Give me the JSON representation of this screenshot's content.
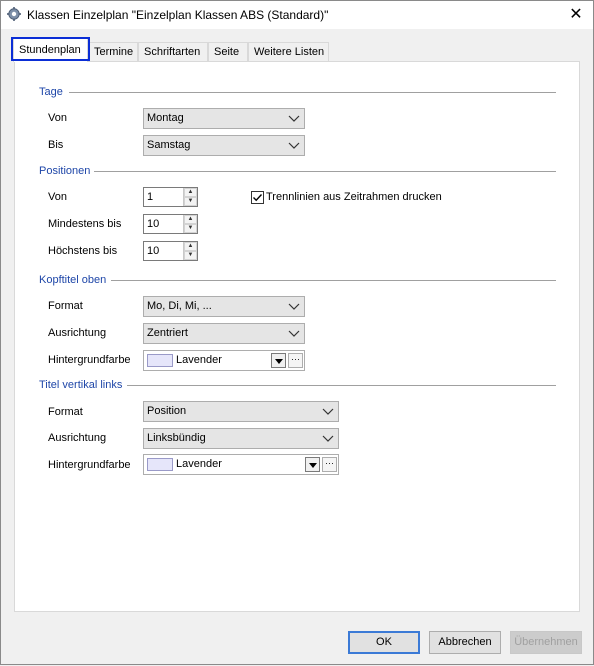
{
  "window": {
    "title": "Klassen Einzelplan \"Einzelplan Klassen ABS (Standard)\"",
    "close_glyph": "✕",
    "app_icon": "gear-icon"
  },
  "tabs": [
    {
      "label": "Stundenplan",
      "active": true
    },
    {
      "label": "Termine",
      "active": false
    },
    {
      "label": "Schriftarten",
      "active": false
    },
    {
      "label": "Seite",
      "active": false
    },
    {
      "label": "Weitere Listen",
      "active": false
    }
  ],
  "sections": {
    "tage": {
      "title": "Tage",
      "von_label": "Von",
      "von_value": "Montag",
      "bis_label": "Bis",
      "bis_value": "Samstag"
    },
    "positionen": {
      "title": "Positionen",
      "von_label": "Von",
      "von_value": "1",
      "min_label": "Mindestens bis",
      "min_value": "10",
      "max_label": "Höchstens bis",
      "max_value": "10",
      "trennlinien_label": "Trennlinien aus Zeitrahmen drucken",
      "trennlinien_checked": true
    },
    "kopftitel": {
      "title": "Kopftitel oben",
      "format_label": "Format",
      "format_value": "Mo, Di, Mi, ...",
      "ausrichtung_label": "Ausrichtung",
      "ausrichtung_value": "Zentriert",
      "hintergrund_label": "Hintergrundfarbe",
      "hintergrund_value": "Lavender",
      "hintergrund_color": "#e6e6fa"
    },
    "titel_vertikal": {
      "title": "Titel vertikal links",
      "format_label": "Format",
      "format_value": "Position",
      "ausrichtung_label": "Ausrichtung",
      "ausrichtung_value": "Linksbündig",
      "hintergrund_label": "Hintergrundfarbe",
      "hintergrund_value": "Lavender",
      "hintergrund_color": "#e6e6fa"
    }
  },
  "buttons": {
    "ok": "OK",
    "abbrechen": "Abbrechen",
    "uebernehmen": "Übernehmen",
    "uebernehmen_enabled": false
  },
  "colors": {
    "section_title": "#1e46a8",
    "focus_border": "#0b2ed6",
    "default_button_border": "#3b7ad6"
  },
  "glyphs": {
    "spin_up": "▲",
    "spin_down": "▼",
    "more": "···"
  }
}
